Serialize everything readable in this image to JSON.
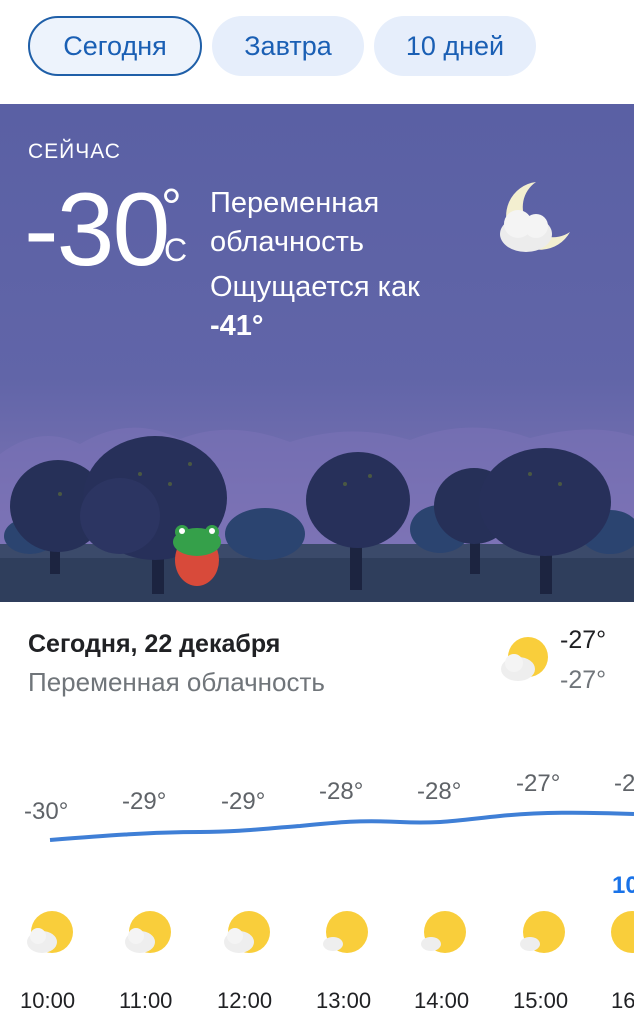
{
  "tabs": [
    {
      "label": "Сегодня",
      "active": true
    },
    {
      "label": "Завтра",
      "active": false
    },
    {
      "label": "10 дней",
      "active": false
    }
  ],
  "current": {
    "label": "СЕЙЧАС",
    "temp": "-30",
    "deg": "°",
    "unit": "C",
    "condition": "Переменная облачность",
    "feels_label": "Ощущается как",
    "feels_value": "-41°",
    "icon": "moon-cloud-icon"
  },
  "today": {
    "title": "Сегодня, 22 декабря",
    "condition": "Переменная облачность",
    "high": "-27°",
    "low": "-27°",
    "icon": "sun-cloud-icon"
  },
  "hourly": [
    {
      "time": "10:00",
      "temp": "-30°",
      "icon": "sun-cloud-icon"
    },
    {
      "time": "11:00",
      "temp": "-29°",
      "icon": "sun-cloud-icon"
    },
    {
      "time": "12:00",
      "temp": "-29°",
      "icon": "sun-cloud-icon"
    },
    {
      "time": "13:00",
      "temp": "-28°",
      "icon": "sun-cloud-icon"
    },
    {
      "time": "14:00",
      "temp": "-28°",
      "icon": "sun-cloud-icon"
    },
    {
      "time": "15:00",
      "temp": "-27°",
      "icon": "sun-cloud-icon"
    },
    {
      "time": "16",
      "temp": "-2",
      "icon": "sun-cloud-icon"
    }
  ],
  "hourly_extra": "10",
  "colors": {
    "accent": "#1a73e8",
    "hero_bg": "#5b63a6",
    "tab_bg": "#e6eefb",
    "sun": "#f9ce3b",
    "line": "#3f7fd6"
  }
}
